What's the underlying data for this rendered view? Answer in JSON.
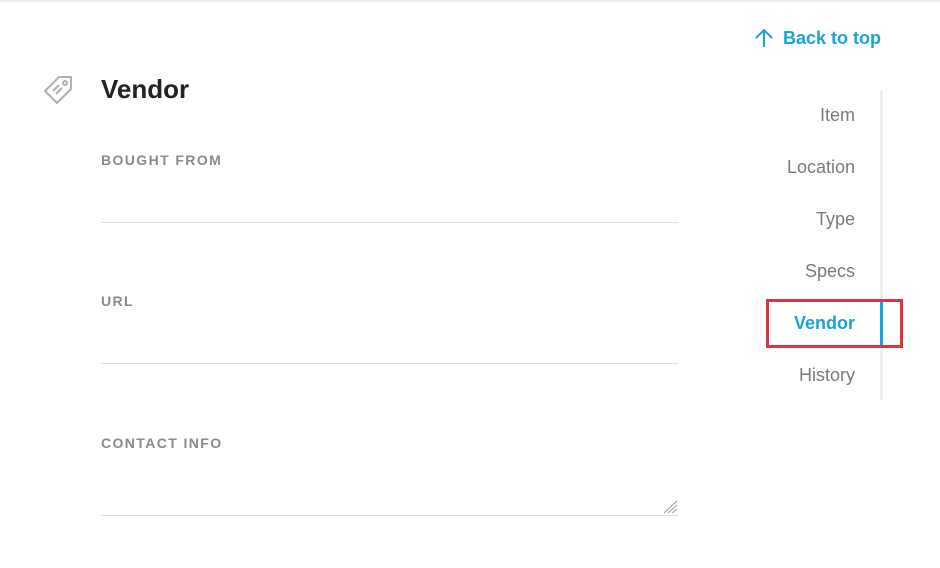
{
  "back_to_top": {
    "label": "Back to top",
    "icon": "arrow-up-icon"
  },
  "section": {
    "icon": "price-tag-icon",
    "title": "Vendor"
  },
  "fields": [
    {
      "label": "BOUGHT FROM",
      "value": "",
      "placeholder": ""
    },
    {
      "label": "URL",
      "value": "",
      "placeholder": ""
    },
    {
      "label": "CONTACT INFO",
      "value": "",
      "placeholder": ""
    }
  ],
  "nav": {
    "items": [
      {
        "label": "Item",
        "active": false
      },
      {
        "label": "Location",
        "active": false
      },
      {
        "label": "Type",
        "active": false
      },
      {
        "label": "Specs",
        "active": false
      },
      {
        "label": "Vendor",
        "active": true
      },
      {
        "label": "History",
        "active": false
      }
    ]
  },
  "colors": {
    "accent": "#1aa3d9",
    "highlight": "#d9363e",
    "nav_text": "#7a7a7a",
    "label_text": "#8a8a8a",
    "title_text": "#222222"
  }
}
